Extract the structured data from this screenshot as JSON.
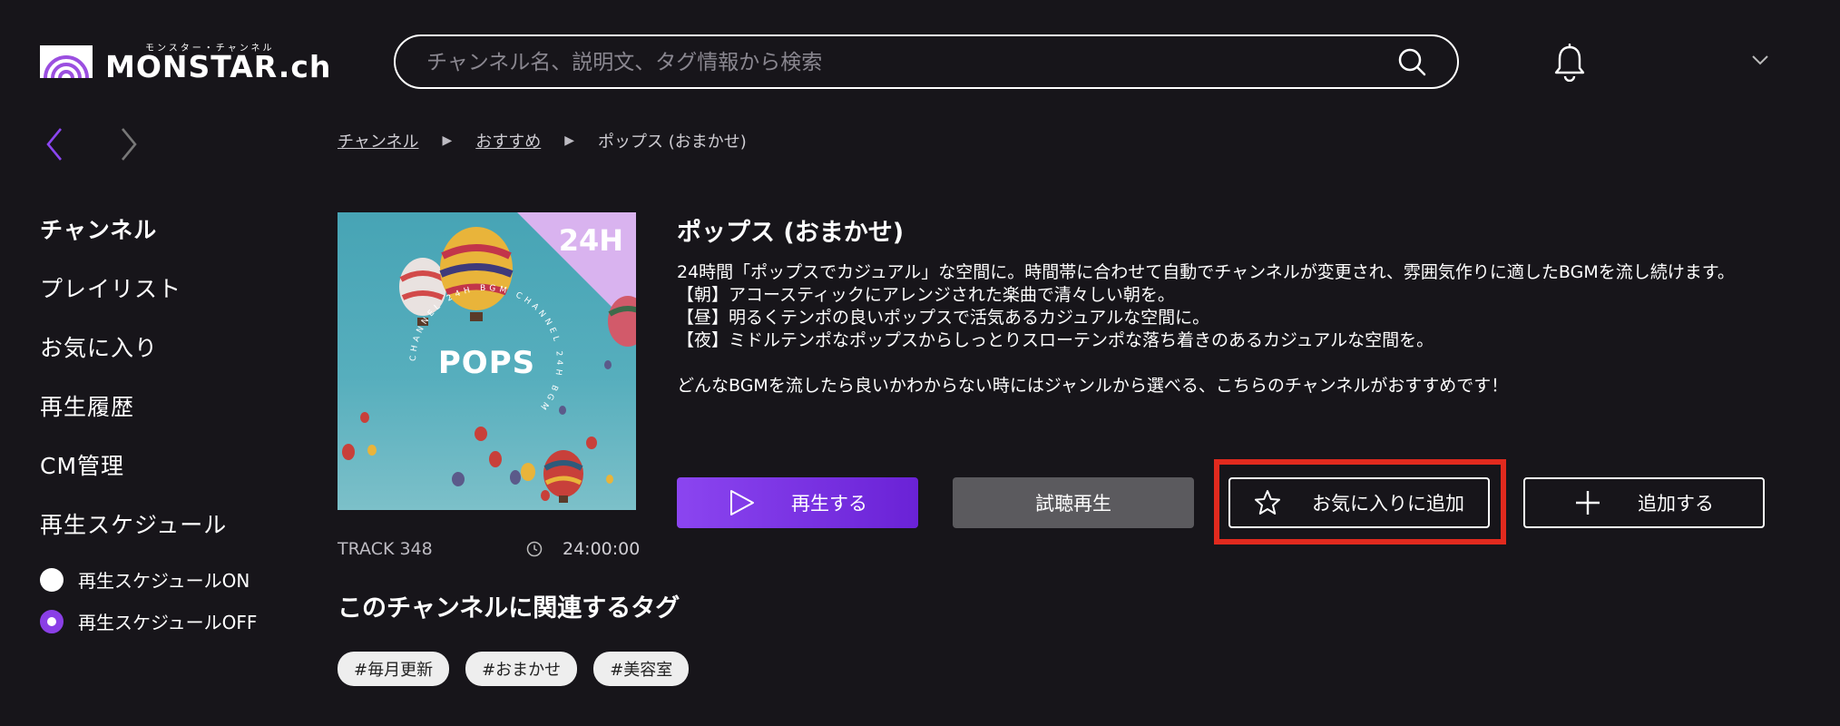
{
  "header": {
    "logo_text": "MONSTAR.ch",
    "logo_kana": "モンスター・チャンネル",
    "search_placeholder": "チャンネル名、説明文、タグ情報から検索"
  },
  "breadcrumb": [
    "チャンネル",
    "おすすめ",
    "ポップス (おまかせ)"
  ],
  "sidebar": {
    "items": [
      "チャンネル",
      "プレイリスト",
      "お気に入り",
      "再生履歴",
      "CM管理",
      "再生スケジュール"
    ],
    "schedule_on": "再生スケジュールON",
    "schedule_off": "再生スケジュールOFF",
    "selected": "再生スケジュールOFF"
  },
  "artwork": {
    "badge": "24H",
    "center_text": "POPS",
    "ring_text": "CHANNEL 24H BGM CHANNEL 24H BGM"
  },
  "channel": {
    "title": "ポップス (おまかせ)",
    "description": "24時間「ポップスでカジュアル」な空間に。時間帯に合わせて自動でチャンネルが変更され、雰囲気作りに適したBGMを流し続けます。\n【朝】アコースティックにアレンジされた楽曲で清々しい朝を。\n【昼】明るくテンポの良いポップスで活気あるカジュアルな空間に。\n【夜】ミドルテンポなポップスからしっとりスローテンポな落ち着きのあるカジュアルな空間を。\n\nどんなBGMを流したら良いかわからない時にはジャンルから選べる、こちらのチャンネルがおすすめです！",
    "track": "TRACK 348",
    "duration": "24:00:00"
  },
  "buttons": {
    "play": "再生する",
    "preview": "試聴再生",
    "favorite": "お気に入りに追加",
    "add": "追加する"
  },
  "tags": {
    "title": "このチャンネルに関連するタグ",
    "items": [
      "#毎月更新",
      "#おまかせ",
      "#美容室"
    ]
  },
  "colors": {
    "background": "#17151a",
    "accent": "#8b45f0",
    "highlight": "#e12a1e",
    "badge": "#d9b3ef"
  }
}
